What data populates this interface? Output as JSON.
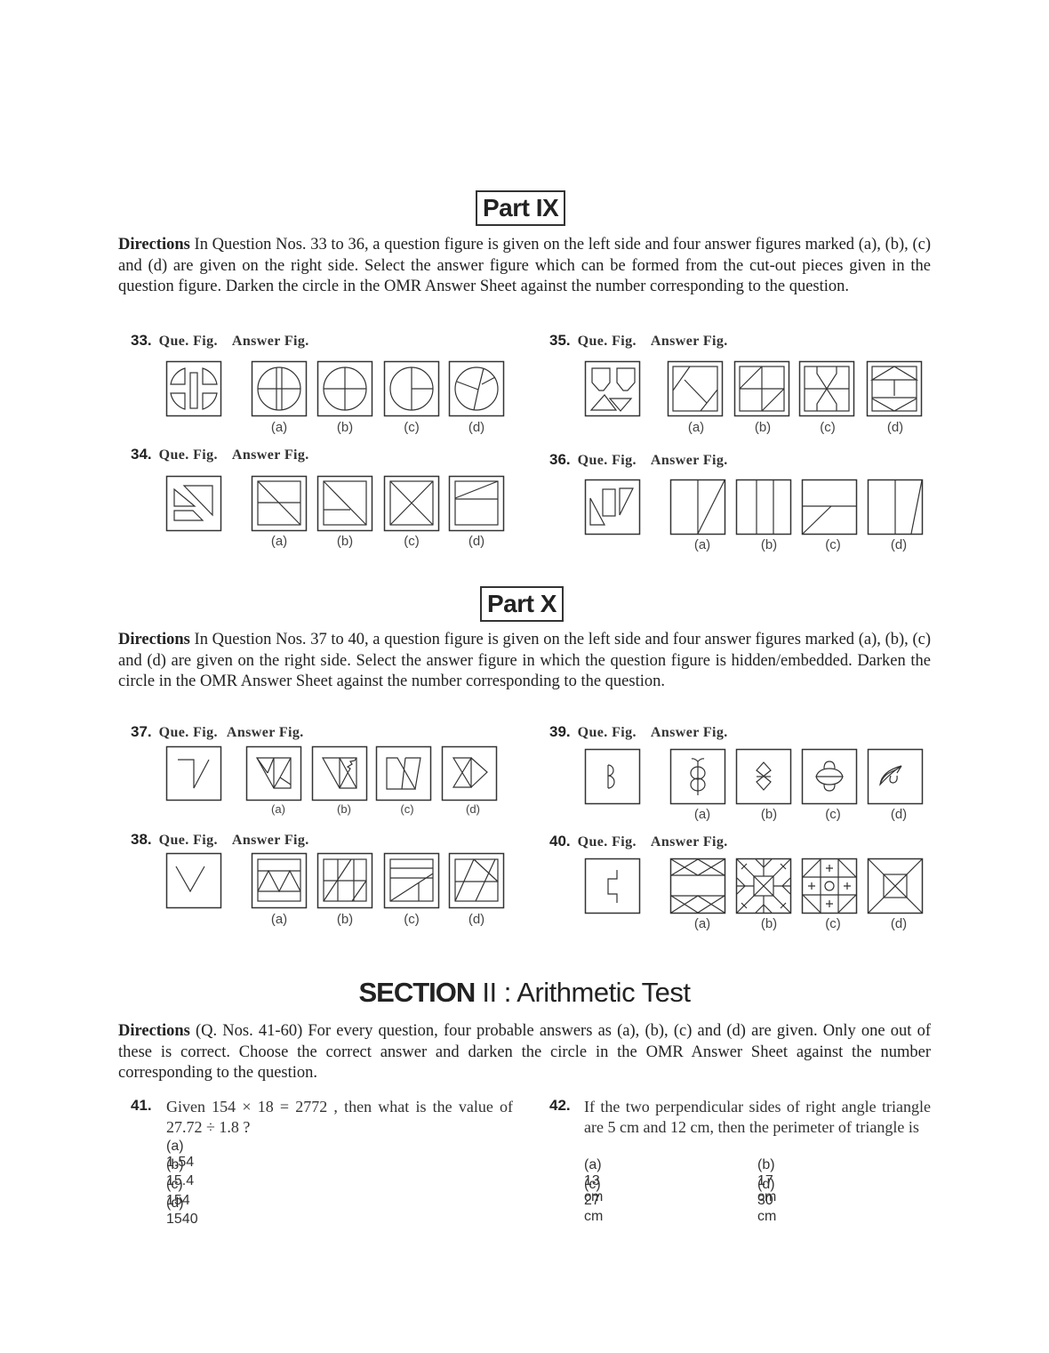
{
  "part9": {
    "title": "Part IX",
    "directions_label": "Directions",
    "directions_text": " In Question Nos. 33 to 36, a question figure is given on the left side and four answer figures marked  (a), (b), (c) and (d) are given on the right side. Select the answer figure which can be formed from the cut-out pieces given in the question figure. Darken the circle in the OMR Answer Sheet against the number corresponding to the question."
  },
  "part10": {
    "title": "Part X",
    "directions_label": "Directions",
    "directions_text": " In Question Nos. 37 to 40, a question figure is given on the left side and four answer figures marked (a), (b), (c) and (d) are given on the right side. Select the answer figure in which the question figure is hidden/embedded. Darken the circle in the OMR Answer Sheet against the number corresponding to the question."
  },
  "figure_labels": {
    "que_fig": "Que. Fig.",
    "answer_fig": "Answer Fig.",
    "options": [
      "(a)",
      "(b)",
      "(c)",
      "(d)"
    ]
  },
  "figure_questions": [
    {
      "number": "33.",
      "question_figure": "four-quarter-circle-pieces-and-bar",
      "answers": [
        "circle-split-bar-cross",
        "circle-cross",
        "circle-half-cross",
        "circle-three-sectors"
      ]
    },
    {
      "number": "34.",
      "question_figure": "triangle-trapezoid-pieces",
      "answers": [
        "square-diagonal-midline",
        "square-diagonal-partial-line",
        "square-x",
        "square-slant-midline"
      ]
    },
    {
      "number": "35.",
      "question_figure": "two-pentagons-two-triangles",
      "answers": [
        "square-tilted-lines",
        "square-cross-diagonals",
        "square-hourglass",
        "square-hexagon-divided"
      ]
    },
    {
      "number": "36.",
      "question_figure": "triangle-rectangle-trapezoid-pieces",
      "answers": [
        "square-vertical-diagonal",
        "square-three-columns",
        "square-horizontal-slant",
        "square-vertical-steep"
      ]
    },
    {
      "number": "37.",
      "question_figure": "z-hook-line",
      "answers": [
        "trapezoid-split-lines",
        "trapezoid-zigzag",
        "parallelogram-cross",
        "hourglass-arrow"
      ]
    },
    {
      "number": "38.",
      "question_figure": "v-shape",
      "answers": [
        "zigzag-band",
        "grid-diagonals",
        "rect-slant-lines",
        "rect-crossing-lines"
      ]
    },
    {
      "number": "39.",
      "question_figure": "b-half-circle",
      "answers": [
        "double-loop-antenna",
        "double-diamond",
        "ufo-shape",
        "leaf-shape"
      ]
    },
    {
      "number": "40.",
      "question_figure": "step-line",
      "answers": [
        "bands-with-x",
        "radial-square-pattern",
        "grid-plus-circle",
        "nested-square-diagonals"
      ]
    }
  ],
  "section2": {
    "title_bold": "SECTION",
    "title_rest": " II :  Arithmetic Test",
    "directions_label": "Directions",
    "directions_text": "  (Q. Nos. 41-60) For every question, four probable answers as (a), (b), (c) and (d) are given. Only one out of these is correct. Choose the correct answer and darken the circle in the OMR Answer Sheet against the number corresponding to the question."
  },
  "arithmetic_questions": [
    {
      "number": "41.",
      "text": "Given 154 × 18 = 2772 , then what is the value of 27.72 ÷ 1.8 ?",
      "options": [
        "(a) 1.54",
        "(b) 15.4",
        "(c) 154",
        "(d) 1540"
      ]
    },
    {
      "number": "42.",
      "text": "If the two perpendicular sides of right angle triangle are 5 cm and 12 cm, then the perimeter of triangle is",
      "options": [
        "(a) 13 cm",
        "(b) 17 cm",
        "(c) 27 cm",
        "(d) 30 cm"
      ]
    }
  ]
}
